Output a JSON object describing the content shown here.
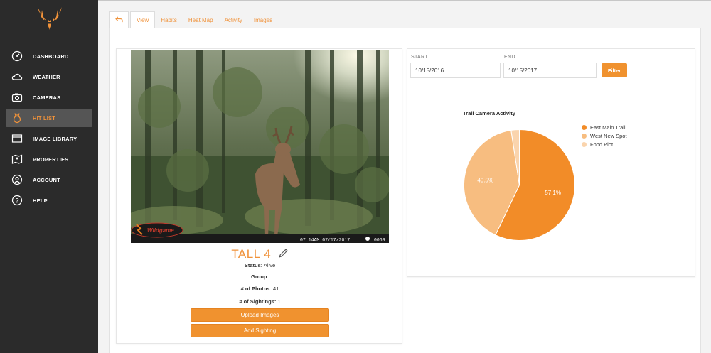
{
  "sidebar": {
    "items": [
      {
        "label": "DASHBOARD",
        "icon": "gauge-icon",
        "active": false
      },
      {
        "label": "WEATHER",
        "icon": "cloud-icon",
        "active": false
      },
      {
        "label": "CAMERAS",
        "icon": "camera-icon",
        "active": false
      },
      {
        "label": "HIT LIST",
        "icon": "hit-list-icon",
        "active": true
      },
      {
        "label": "IMAGE LIBRARY",
        "icon": "library-icon",
        "active": false
      },
      {
        "label": "PROPERTIES",
        "icon": "map-icon",
        "active": false
      },
      {
        "label": "ACCOUNT",
        "icon": "user-icon",
        "active": false
      },
      {
        "label": "HELP",
        "icon": "help-icon",
        "active": false
      }
    ]
  },
  "tabs": {
    "back_icon": "back-arrow-icon",
    "items": [
      "View",
      "Habits",
      "Heat Map",
      "Activity",
      "Images"
    ],
    "active": "View"
  },
  "deer": {
    "name": "TALL 4",
    "status_label": "Status:",
    "status_value": "Alive",
    "group_label": "Group:",
    "group_value": "",
    "photos_label": "# of Photos:",
    "photos_value": "41",
    "sightings_label": "# of Sightings:",
    "sightings_value": "1",
    "upload_label": "Upload Images",
    "sighting_label": "Add Sighting",
    "photo": {
      "stamp": "07 14AM 07/17/2017",
      "frame": "0069",
      "brand": "Wildgame"
    }
  },
  "filter": {
    "start_label": "START",
    "start_value": "10/15/2016",
    "end_label": "END",
    "end_value": "10/15/2017",
    "button_label": "Filter"
  },
  "colors": {
    "accent": "#f0922f",
    "sidebar": "#2b2b2b"
  },
  "chart_data": {
    "type": "pie",
    "title": "Trail Camera Activity",
    "legend_position": "right",
    "series": [
      {
        "name": "East Main Trail",
        "value": 57.1,
        "color": "#f28c28",
        "label": "57.1%"
      },
      {
        "name": "West New Spot",
        "value": 40.5,
        "color": "#f7bd80",
        "label": "40.5%"
      },
      {
        "name": "Food Plot",
        "value": 2.4,
        "color": "#fad4ad",
        "label": ""
      }
    ]
  }
}
